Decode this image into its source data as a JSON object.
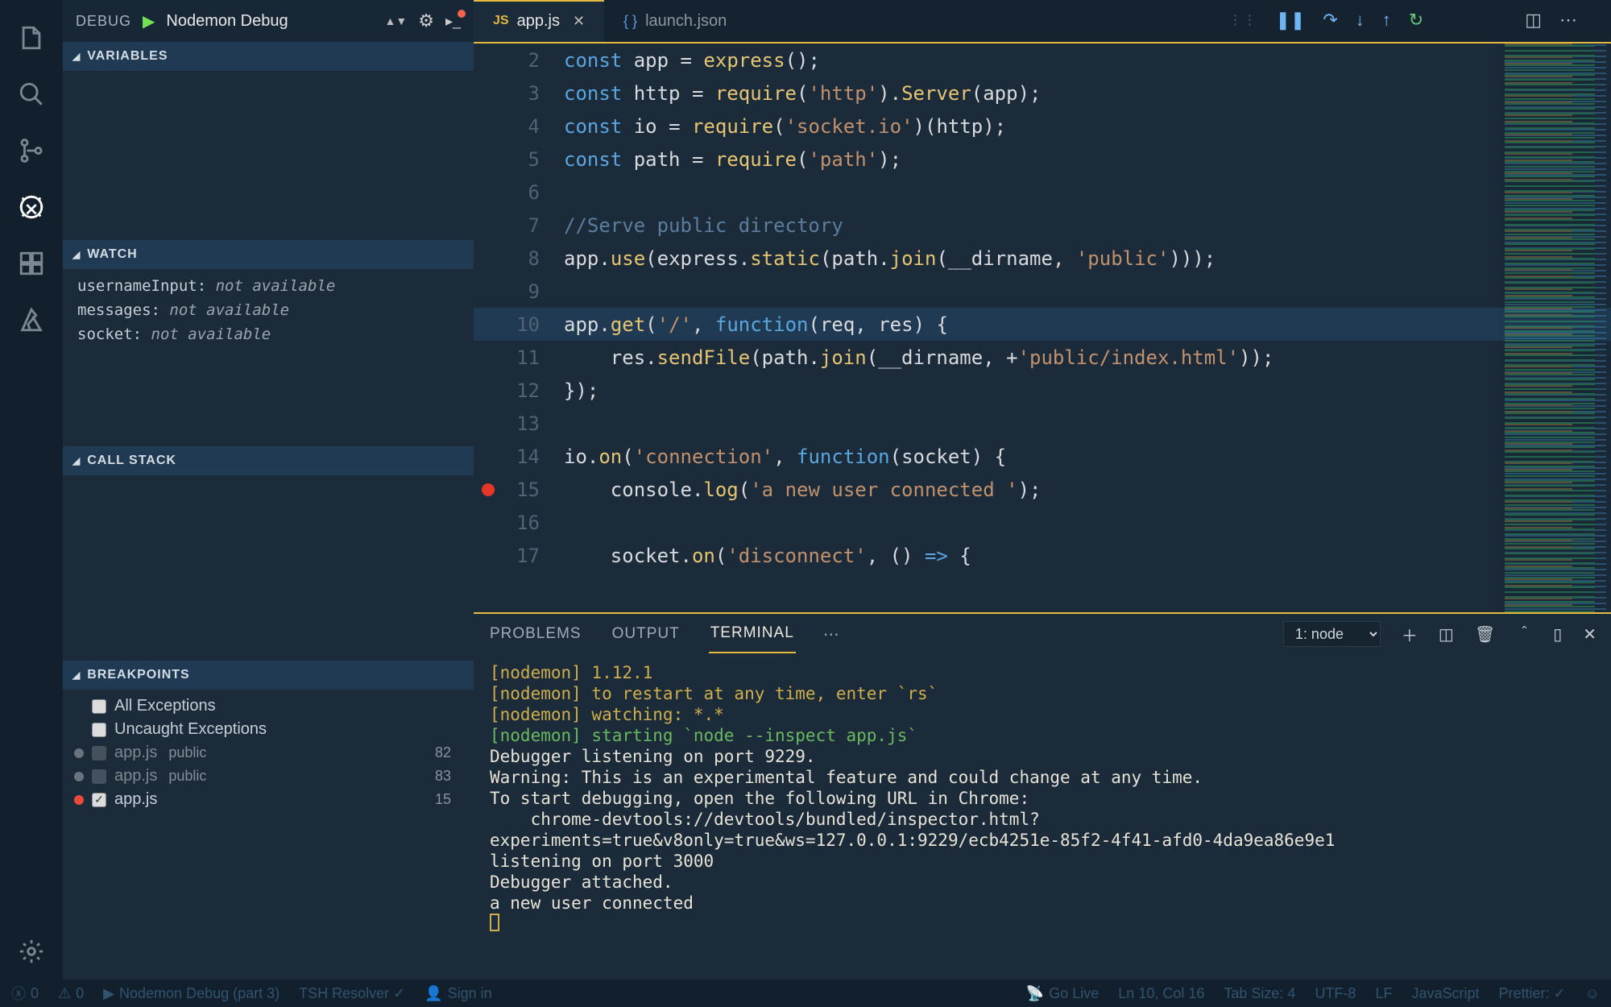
{
  "debug": {
    "label": "DEBUG",
    "config": "Nodemon Debug"
  },
  "sections": {
    "variables": "VARIABLES",
    "watch": "WATCH",
    "callstack": "CALL STACK",
    "breakpoints": "BREAKPOINTS"
  },
  "watch": [
    {
      "name": "usernameInput:",
      "value": "not available"
    },
    {
      "name": "messages:",
      "value": "not available"
    },
    {
      "name": "socket:",
      "value": "not available"
    }
  ],
  "breakpoints": {
    "allExceptions": "All Exceptions",
    "uncaught": "Uncaught Exceptions",
    "items": [
      {
        "file": "app.js",
        "path": "public",
        "line": "82",
        "checked": false,
        "color": "grey"
      },
      {
        "file": "app.js",
        "path": "public",
        "line": "83",
        "checked": false,
        "color": "grey"
      },
      {
        "file": "app.js",
        "path": "",
        "line": "15",
        "checked": true,
        "color": "red"
      }
    ]
  },
  "tabs": {
    "active": "app.js",
    "other": "launch.json"
  },
  "code": {
    "lines": [
      {
        "n": "2",
        "bp": false,
        "hl": false,
        "html": "<span class='tok-kw'>const</span> <span class='tok-id'>app</span> <span class='tok-op'>=</span> <span class='tok-fn'>express</span><span class='tok-pun'>();</span>"
      },
      {
        "n": "3",
        "bp": false,
        "hl": false,
        "html": "<span class='tok-kw'>const</span> <span class='tok-id'>http</span> <span class='tok-op'>=</span> <span class='tok-fn'>require</span><span class='tok-pun'>(</span><span class='tok-str'>'http'</span><span class='tok-pun'>).</span><span class='tok-fn'>Server</span><span class='tok-pun'>(</span><span class='tok-id'>app</span><span class='tok-pun'>);</span>"
      },
      {
        "n": "4",
        "bp": false,
        "hl": false,
        "html": "<span class='tok-kw'>const</span> <span class='tok-id'>io</span> <span class='tok-op'>=</span> <span class='tok-fn'>require</span><span class='tok-pun'>(</span><span class='tok-str'>'socket.io'</span><span class='tok-pun'>)(</span><span class='tok-id'>http</span><span class='tok-pun'>);</span>"
      },
      {
        "n": "5",
        "bp": false,
        "hl": false,
        "html": "<span class='tok-kw'>const</span> <span class='tok-id'>path</span> <span class='tok-op'>=</span> <span class='tok-fn'>require</span><span class='tok-pun'>(</span><span class='tok-str'>'path'</span><span class='tok-pun'>);</span>"
      },
      {
        "n": "6",
        "bp": false,
        "hl": false,
        "html": ""
      },
      {
        "n": "7",
        "bp": false,
        "hl": false,
        "html": "<span class='tok-cmt'>//Serve public directory</span>"
      },
      {
        "n": "8",
        "bp": false,
        "hl": false,
        "html": "<span class='tok-id'>app</span><span class='tok-pun'>.</span><span class='tok-fn'>use</span><span class='tok-pun'>(</span><span class='tok-id'>express</span><span class='tok-pun'>.</span><span class='tok-fn'>static</span><span class='tok-pun'>(</span><span class='tok-id'>path</span><span class='tok-pun'>.</span><span class='tok-fn'>join</span><span class='tok-pun'>(</span><span class='tok-id'>__dirname</span><span class='tok-pun'>, </span><span class='tok-str'>'public'</span><span class='tok-pun'>)));</span>"
      },
      {
        "n": "9",
        "bp": false,
        "hl": false,
        "html": ""
      },
      {
        "n": "10",
        "bp": false,
        "hl": true,
        "html": "<span class='tok-id'>app</span><span class='tok-pun'>.</span><span class='tok-fn'>get</span><span class='tok-pun'>(</span><span class='tok-str'>'/'</span><span class='tok-pun'>, </span><span class='tok-kw'>function</span><span class='tok-pun'>(</span><span class='tok-id'>req</span><span class='tok-pun'>, </span><span class='tok-id'>res</span><span class='tok-pun'>) {</span>"
      },
      {
        "n": "11",
        "bp": false,
        "hl": false,
        "html": "    <span class='tok-id'>res</span><span class='tok-pun'>.</span><span class='tok-fn'>sendFile</span><span class='tok-pun'>(</span><span class='tok-id'>path</span><span class='tok-pun'>.</span><span class='tok-fn'>join</span><span class='tok-pun'>(</span><span class='tok-id'>__dirname</span><span class='tok-pun'>, +</span><span class='tok-str'>'public/index.html'</span><span class='tok-pun'>));</span>"
      },
      {
        "n": "12",
        "bp": false,
        "hl": false,
        "html": "<span class='tok-pun'>});</span>"
      },
      {
        "n": "13",
        "bp": false,
        "hl": false,
        "html": ""
      },
      {
        "n": "14",
        "bp": false,
        "hl": false,
        "html": "<span class='tok-id'>io</span><span class='tok-pun'>.</span><span class='tok-fn'>on</span><span class='tok-pun'>(</span><span class='tok-str'>'connection'</span><span class='tok-pun'>, </span><span class='tok-kw'>function</span><span class='tok-pun'>(</span><span class='tok-id'>socket</span><span class='tok-pun'>) {</span>"
      },
      {
        "n": "15",
        "bp": true,
        "hl": false,
        "html": "    <span class='tok-id'>console</span><span class='tok-pun'>.</span><span class='tok-fn'>log</span><span class='tok-pun'>(</span><span class='tok-str'>'a new user connected '</span><span class='tok-pun'>);</span>"
      },
      {
        "n": "16",
        "bp": false,
        "hl": false,
        "html": ""
      },
      {
        "n": "17",
        "bp": false,
        "hl": false,
        "html": "    <span class='tok-id'>socket</span><span class='tok-pun'>.</span><span class='tok-fn'>on</span><span class='tok-pun'>(</span><span class='tok-str'>'disconnect'</span><span class='tok-pun'>, () </span><span class='tok-kw'>=&gt;</span><span class='tok-pun'> {</span>"
      }
    ]
  },
  "panel": {
    "tabs": {
      "problems": "PROBLEMS",
      "output": "OUTPUT",
      "terminal": "TERMINAL"
    },
    "termSelect": "1: node"
  },
  "terminal": {
    "lines": [
      {
        "cls": "t-ndm",
        "text": "[nodemon] 1.12.1"
      },
      {
        "cls": "t-ndm",
        "text": "[nodemon] to restart at any time, enter `rs`"
      },
      {
        "cls": "t-ndm",
        "text": "[nodemon] watching: *.*"
      },
      {
        "cls": "t-green",
        "text": "[nodemon] starting `node --inspect app.js`"
      },
      {
        "cls": "",
        "text": "Debugger listening on port 9229."
      },
      {
        "cls": "",
        "text": "Warning: This is an experimental feature and could change at any time."
      },
      {
        "cls": "",
        "text": "To start debugging, open the following URL in Chrome:"
      },
      {
        "cls": "",
        "text": "    chrome-devtools://devtools/bundled/inspector.html?experiments=true&v8only=true&ws=127.0.0.1:9229/ecb4251e-85f2-4f41-afd0-4da9ea86e9e1"
      },
      {
        "cls": "",
        "text": "listening on port 3000"
      },
      {
        "cls": "",
        "text": "Debugger attached."
      },
      {
        "cls": "",
        "text": "a new user connected"
      }
    ]
  },
  "status": {
    "errors": "0",
    "warnings": "0",
    "debugName": "Nodemon Debug (part 3)",
    "resolver": "TSH Resolver ✓",
    "signin": "Sign in",
    "golive": "Go Live",
    "pos": "Ln 10, Col 16",
    "tab": "Tab Size: 4",
    "enc": "UTF-8",
    "eol": "LF",
    "lang": "JavaScript",
    "prettier": "Prettier: ✓"
  }
}
